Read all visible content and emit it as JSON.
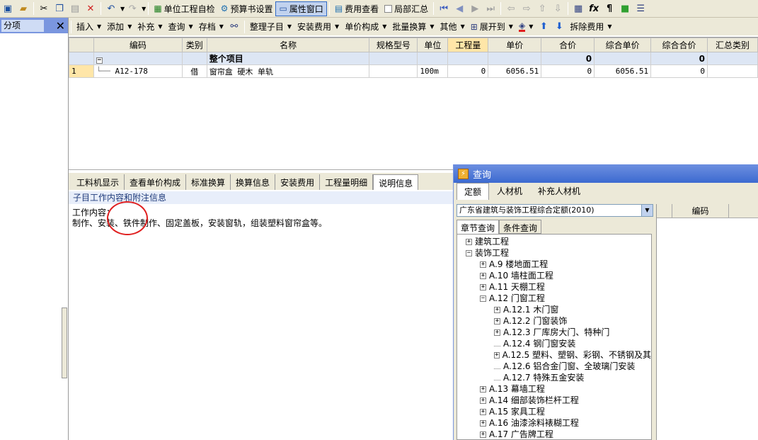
{
  "toolbar1": {
    "self_check": "单位工程自检",
    "budget_settings": "预算书设置",
    "property_window": "属性窗口",
    "fee_view": "费用查看",
    "partial_summary": "局部汇总"
  },
  "toolbar2": {
    "insert": "插入",
    "add": "添加",
    "supplement": "补充",
    "query": "查询",
    "archive": "存档",
    "organize": "整理子目",
    "install_fee": "安装费用",
    "unit_price": "单价构成",
    "batch_convert": "批量换算",
    "other": "其他",
    "expand": "展开到",
    "remove_fee": "拆除费用"
  },
  "left_panel": {
    "title": "分项"
  },
  "grid": {
    "headers": [
      "编码",
      "类别",
      "名称",
      "规格型号",
      "单位",
      "工程量",
      "单价",
      "合价",
      "综合单价",
      "综合合价",
      "汇总类别"
    ],
    "total_row": {
      "toggle": "−",
      "name": "整个项目",
      "sum": "0",
      "comp_sum": "0"
    },
    "rows": [
      {
        "no": "1",
        "code": "A12-178",
        "type": "借",
        "name": "窗帘盒 硬木 单轨",
        "spec": "",
        "unit": "100m",
        "qty": "0",
        "price": "6056.51",
        "total": "0",
        "comp_price": "6056.51",
        "comp_total": "0",
        "category": ""
      }
    ]
  },
  "bottom_tabs": [
    "工料机显示",
    "查看单价构成",
    "标准换算",
    "换算信息",
    "安装费用",
    "工程量明细",
    "说明信息"
  ],
  "subhead": "子目工作内容和附注信息",
  "description": {
    "line1": "工作内容：",
    "line2": "制作、安装、铁件制作、固定盖板，安装窗轨，组装塑料窗帘盒等。"
  },
  "query": {
    "title": "查询",
    "tabs": [
      "定额",
      "人材机",
      "补充人材机"
    ],
    "selector": "广东省建筑与装饰工程综合定额(2010)",
    "subtabs": [
      "章节查询",
      "条件查询"
    ],
    "right_header": "编码",
    "tree": [
      {
        "label": "建筑工程",
        "level": 0,
        "toggle": "+"
      },
      {
        "label": "装饰工程",
        "level": 0,
        "toggle": "−"
      },
      {
        "label": "A.9 楼地面工程",
        "level": 1,
        "toggle": "+"
      },
      {
        "label": "A.10 墙柱面工程",
        "level": 1,
        "toggle": "+"
      },
      {
        "label": "A.11 天棚工程",
        "level": 1,
        "toggle": "+"
      },
      {
        "label": "A.12 门窗工程",
        "level": 1,
        "toggle": "−"
      },
      {
        "label": "A.12.1 木门窗",
        "level": 2,
        "toggle": "+"
      },
      {
        "label": "A.12.2 门窗装饰",
        "level": 2,
        "toggle": "+"
      },
      {
        "label": "A.12.3 厂库房大门、特种门",
        "level": 2,
        "toggle": "+"
      },
      {
        "label": "A.12.4 钢门窗安装",
        "level": 2,
        "toggle": ""
      },
      {
        "label": "A.12.5 塑料、塑钢、彩钢、不锈钢及其",
        "level": 2,
        "toggle": "+"
      },
      {
        "label": "A.12.6 铝合金门窗、全玻璃门安装",
        "level": 2,
        "toggle": ""
      },
      {
        "label": "A.12.7 特殊五金安装",
        "level": 2,
        "toggle": ""
      },
      {
        "label": "A.13 幕墙工程",
        "level": 1,
        "toggle": "+"
      },
      {
        "label": "A.14 细部装饰栏杆工程",
        "level": 1,
        "toggle": "+"
      },
      {
        "label": "A.15 家具工程",
        "level": 1,
        "toggle": "+"
      },
      {
        "label": "A.16 油漆涂料裱糊工程",
        "level": 1,
        "toggle": "+"
      },
      {
        "label": "A.17 广告牌工程",
        "level": 1,
        "toggle": "+"
      }
    ]
  },
  "colors": {
    "accent": "#316ac5",
    "highlight": "#ffe6a8",
    "annotation": "#e02020"
  }
}
